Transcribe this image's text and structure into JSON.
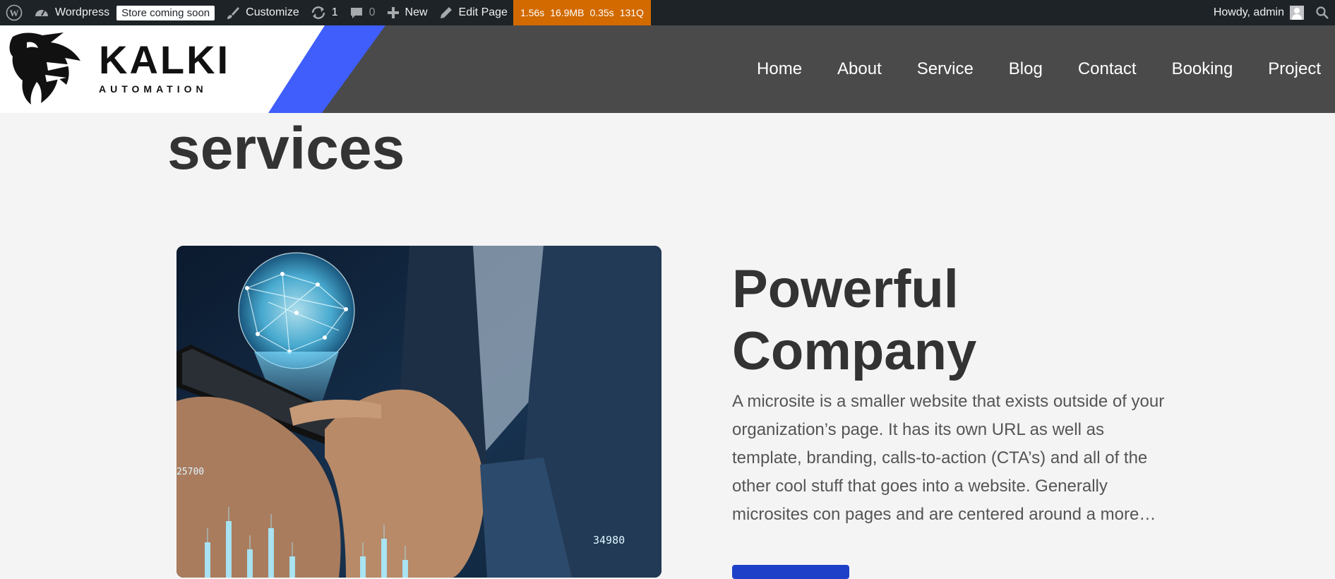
{
  "adminbar": {
    "site_name": "Wordpress",
    "store_badge": "Store coming soon",
    "customize": "Customize",
    "updates_count": "1",
    "comments_count": "0",
    "new_label": "New",
    "edit_page": "Edit Page",
    "qm": {
      "time": "1.56s",
      "memory": "16.9MB",
      "db_time": "0.35s",
      "queries": "131Q"
    },
    "howdy": "Howdy, admin"
  },
  "header": {
    "logo_title": "KALKI",
    "logo_subtitle": "AUTOMATION",
    "nav": [
      "Home",
      "About",
      "Service",
      "Blog",
      "Contact",
      "Booking",
      "Project"
    ]
  },
  "main": {
    "section_title": "services",
    "heading": "Powerful Company",
    "description": "A microsite is a smaller website that exists outside of your organization’s page. It has its own URL as well as template, branding, calls-to-action (CTA’s) and all of the other cool stuff that goes into a website. Generally microsites con pages and are centered around a more…",
    "image_labels": {
      "left": "25700",
      "right": "34980"
    }
  },
  "colors": {
    "admin_bar": "#1d2327",
    "qm_orange": "#d26a00",
    "header_bg": "#4a4a4a",
    "accent_blue": "#3f5efb",
    "button_blue": "#1e40c8"
  }
}
